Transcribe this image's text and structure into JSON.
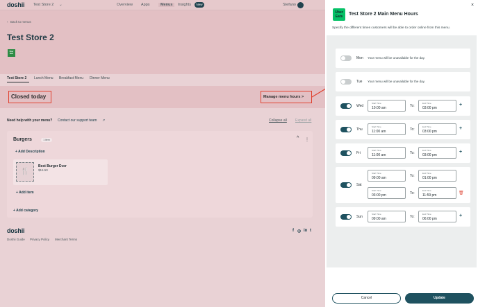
{
  "app": {
    "logo": "doshii",
    "store_selector": "Test Store 2"
  },
  "nav": {
    "items": [
      "Overview",
      "Apps",
      "Menus",
      "Insights"
    ],
    "new_badge": "New",
    "user": "Stefano"
  },
  "breadcrumb": "Back to menus",
  "page_title": "Test Store 2",
  "store_logo_text": "Uber Eats",
  "tabs": [
    "Test Store 2",
    "Lunch Menu",
    "Breakfast Menu",
    "Dinner Menu"
  ],
  "status": {
    "closed_label": "Closed today",
    "manage_label": "Manage menu hours >"
  },
  "help": {
    "text": "Need help with your menu?",
    "link": "Contact our support team",
    "collapse": "Collapse all",
    "expand": "Expand all"
  },
  "category": {
    "name": "Burgers",
    "badge": "1 item",
    "add_description": "+ Add Description",
    "item_name": "Best Burger Ever",
    "item_price": "$16.50",
    "add_item": "+ Add item",
    "add_category": "+ Add category"
  },
  "footer": {
    "logo": "doshii",
    "links": [
      "Doshii Guide",
      "Privacy Policy",
      "Merchant Terms"
    ],
    "social": [
      "f",
      "◎",
      "in",
      "t"
    ]
  },
  "panel": {
    "badge_text": "Uber Eats",
    "title": "Test Store 2 Main Menu Hours",
    "subtitle": "Specify the different times customers will be able to order online from this menu.",
    "close": "×",
    "start_label": "Start Time",
    "end_label": "End Time",
    "to_label": "To:",
    "unavailable": "Your menu will be unavailable for the day.",
    "days": [
      {
        "day": "Mon",
        "enabled": false
      },
      {
        "day": "Tue",
        "enabled": false
      },
      {
        "day": "Wed",
        "enabled": true,
        "slots": [
          {
            "start": "10:00 am",
            "end": "03:00 pm"
          }
        ]
      },
      {
        "day": "Thu",
        "enabled": true,
        "slots": [
          {
            "start": "11:00 am",
            "end": "03:00 pm"
          }
        ]
      },
      {
        "day": "Fri",
        "enabled": true,
        "slots": [
          {
            "start": "11:00 am",
            "end": "03:00 pm"
          }
        ]
      },
      {
        "day": "Sat",
        "enabled": true,
        "slots": [
          {
            "start": "09:00 am",
            "end": "01:00 pm"
          },
          {
            "start": "03:00 pm",
            "end": "11:59 pm"
          }
        ]
      },
      {
        "day": "Sun",
        "enabled": true,
        "slots": [
          {
            "start": "09:00 am",
            "end": "06:00 pm"
          }
        ]
      }
    ],
    "cancel": "Cancel",
    "update": "Update"
  },
  "colors": {
    "accent": "#1f5260",
    "highlight": "#e0402e",
    "uber": "#06c167"
  }
}
